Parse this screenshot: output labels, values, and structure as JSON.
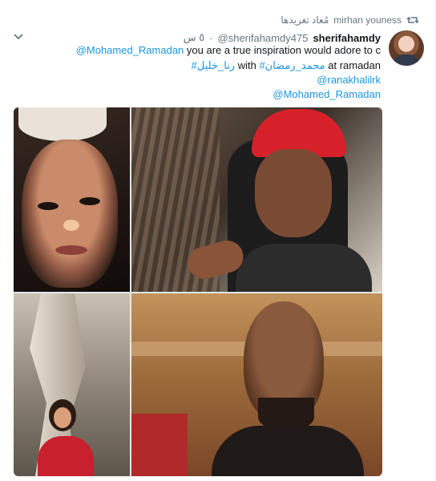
{
  "retweet": {
    "retweeter_name": "mirhan youness",
    "label": "مُعاد تغريدها",
    "icon": "retweet-icon"
  },
  "author": {
    "display_name": "sherifahamdy",
    "screen_name": "@sherifahamdy475",
    "separator": "·",
    "time": "٥ س"
  },
  "tweet": {
    "line1_mention": "@Mohamed_Ramadan",
    "line1_text": " you are a true inspiration would adore to c",
    "line2_hashtag1": "#رنا_خليل",
    "line2_with": " with ",
    "line2_hashtag2": "#محمد_رمضان",
    "line2_at": " at ramadan",
    "line3_mention": "@ranakhalilrk",
    "line4_mention": "@Mohamed_Ramadan"
  },
  "icons": {
    "caret": "chevron-down-icon",
    "retweet": "retweet-icon"
  },
  "colors": {
    "link": "#1b95e0",
    "muted": "#657786",
    "text": "#14171a"
  },
  "media": {
    "photos": [
      "photo-top-left",
      "photo-top-right",
      "photo-bottom-left",
      "photo-bottom-right"
    ]
  }
}
